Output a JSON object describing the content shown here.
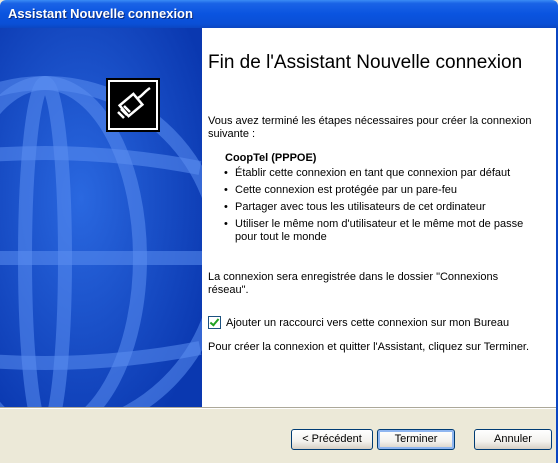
{
  "window": {
    "title": "Assistant Nouvelle connexion"
  },
  "content": {
    "heading": "Fin de l'Assistant Nouvelle connexion",
    "intro": "Vous avez terminé les étapes nécessaires pour créer la connexion suivante :",
    "connection_name": "CoopTel (PPPOE)",
    "bullets": [
      "Établir cette connexion en tant que connexion par défaut",
      "Cette connexion est protégée par un pare-feu",
      "Partager avec tous les utilisateurs de cet ordinateur",
      "Utiliser le même nom d'utilisateur et le même mot de passe pour tout le monde"
    ],
    "folder_note": "La connexion sera enregistrée dans le dossier \"Connexions réseau\".",
    "shortcut_checkbox": {
      "label": "Ajouter un raccourci vers cette connexion sur mon Bureau",
      "checked": true
    },
    "finish_note": "Pour créer la connexion et quitter l'Assistant, cliquez sur Terminer."
  },
  "buttons": {
    "previous": "< Précédent",
    "finish": "Terminer",
    "cancel": "Annuler"
  },
  "colors": {
    "titlebar": "#0a54e0",
    "sidebar": "#0b3fbf",
    "face": "#ece9d8"
  },
  "icons": {
    "wizard": "network-cable-icon"
  }
}
